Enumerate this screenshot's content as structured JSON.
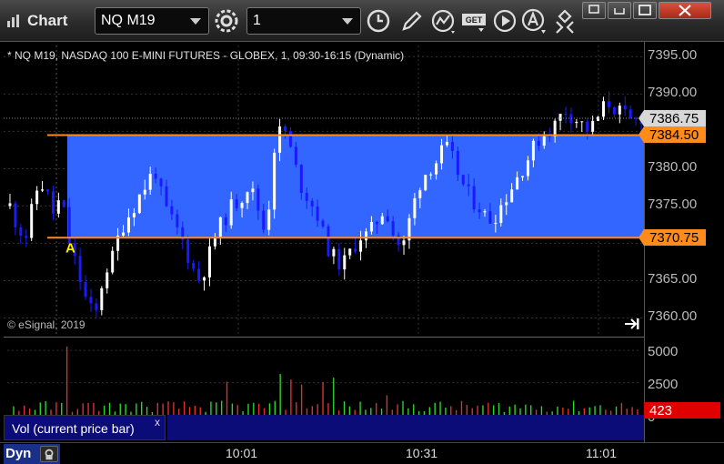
{
  "window": {
    "title": "Chart",
    "symbol_value": "NQ M19",
    "interval_value": "1",
    "colors": {
      "titlebar": "#2b2b2b",
      "band": "#3366ff",
      "line": "#ff8c1a",
      "up": "#ffffff",
      "down": "#1a1aff",
      "vol_bg": "#0c0c78",
      "price_tag": "#ff8c1a",
      "vol_tag": "#e00000"
    }
  },
  "toolbar": {
    "icons": [
      "gear-icon",
      "clock-icon",
      "pencil-icon",
      "studies-icon",
      "get-icon",
      "play-icon",
      "alert-icon",
      "move-icon"
    ]
  },
  "chart": {
    "symbol_line": "* NQ M19, NASDAQ 100 E-MINI FUTURES - GLOBEX, 1, 09:30-16:15 (Dynamic)",
    "copyright": "© eSignal, 2019",
    "marker_label": "A",
    "y_labels": [
      "7395.00",
      "7390.00",
      "7385.00",
      "7380.00",
      "7375.00",
      "7370.00",
      "7365.00",
      "7360.00"
    ],
    "last_price_tag": "7386.75",
    "upper_line_tag": "7384.50",
    "lower_line_tag": "7370.75",
    "vol_labels": [
      "5000",
      "2500",
      "0"
    ],
    "vol_tag": "423",
    "vol_panel_label": "Vol (current price bar)",
    "vol_close": "x",
    "time_labels": [
      "10:01",
      "10:31",
      "11:01"
    ],
    "dyn_label": "Dyn"
  },
  "chart_data": {
    "type": "candlestick",
    "ylim": [
      7357.5,
      7396.5
    ],
    "upper_line": 7384.5,
    "lower_line": 7370.75,
    "last": 7386.75,
    "vol_ylim": [
      0,
      6000
    ],
    "volume_last": 423
  }
}
